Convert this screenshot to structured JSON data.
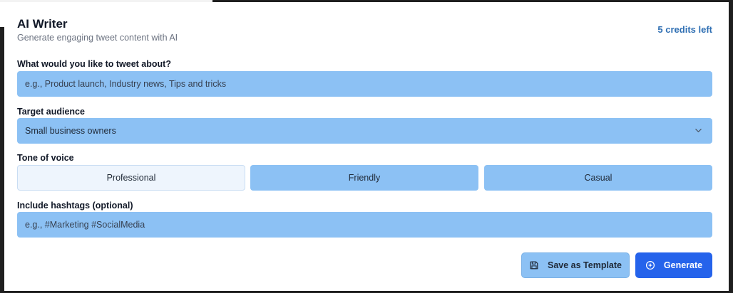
{
  "header": {
    "title": "AI Writer",
    "subtitle": "Generate engaging tweet content with AI",
    "credits": "5 credits left"
  },
  "form": {
    "topic": {
      "label": "What would you like to tweet about?",
      "placeholder": "e.g., Product launch, Industry news, Tips and tricks",
      "value": ""
    },
    "audience": {
      "label": "Target audience",
      "selected": "Small business owners",
      "icon": "chevron-down-icon"
    },
    "tone": {
      "label": "Tone of voice",
      "options": [
        "Professional",
        "Friendly",
        "Casual"
      ],
      "selected": "Professional"
    },
    "hashtags": {
      "label": "Include hashtags (optional)",
      "placeholder": "e.g., #Marketing #SocialMedia",
      "value": ""
    }
  },
  "actions": {
    "save_label": "Save as Template",
    "save_icon": "save-icon",
    "generate_label": "Generate",
    "generate_icon": "sparkle-icon"
  },
  "colors": {
    "field_bg": "#8cc1f4",
    "selected_tone_bg": "#eef5fd",
    "primary": "#2563eb",
    "credits_text": "#2f6fb3"
  }
}
